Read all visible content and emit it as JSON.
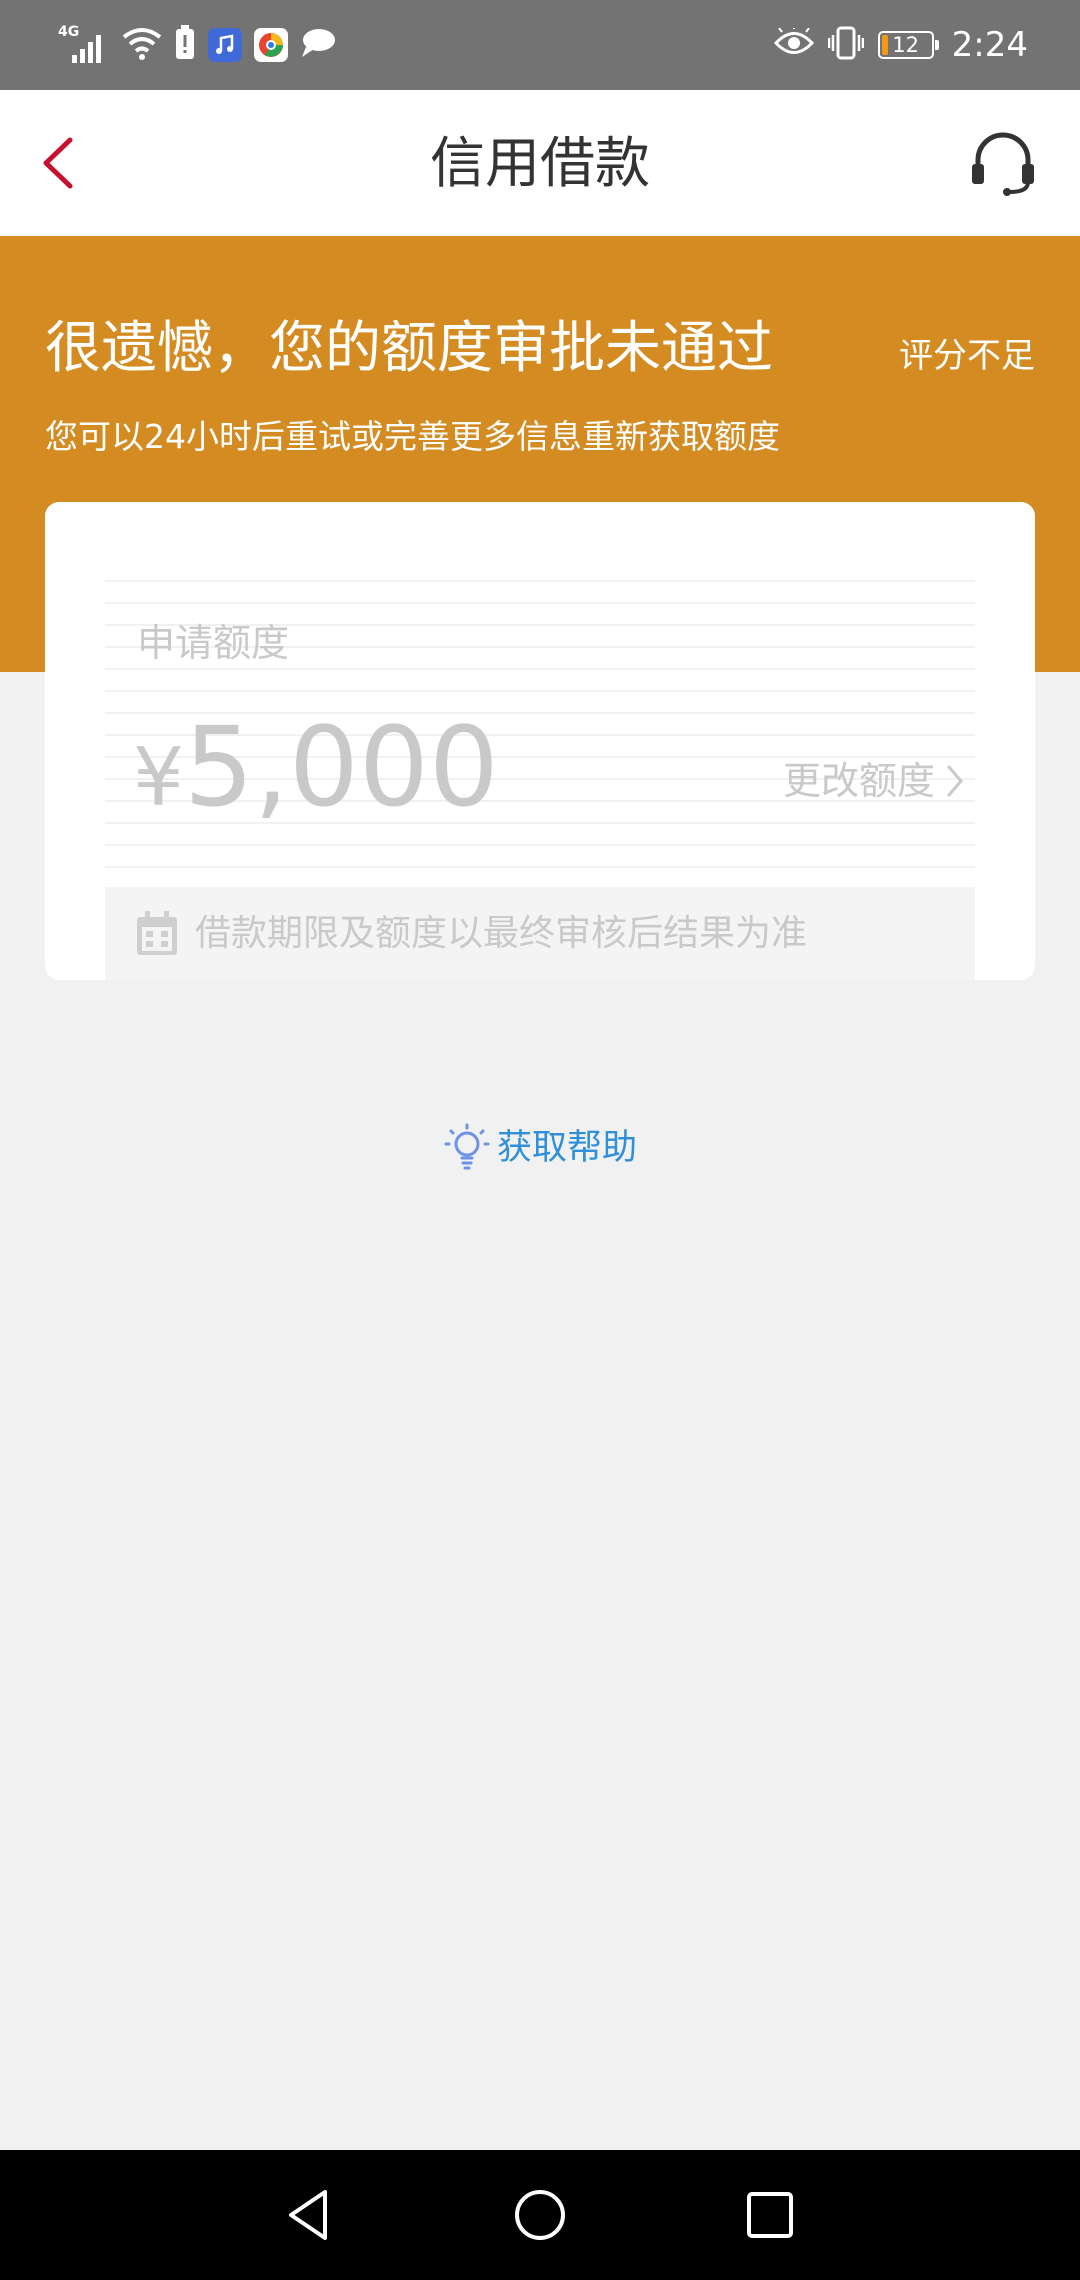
{
  "status_bar": {
    "network_type": "4G",
    "time": "2:24",
    "battery_level": "12",
    "battery_fraction": 0.12,
    "left_icons": [
      "signal-icon",
      "wifi-icon",
      "battery-alert-icon",
      "music-app-icon",
      "browser-app-icon",
      "chat-bubble-icon"
    ],
    "right_icons": [
      "eye-icon",
      "vibrate-icon",
      "battery-icon"
    ]
  },
  "header": {
    "title": "信用借款",
    "back_icon": "chevron-left-icon",
    "support_icon": "headset-icon"
  },
  "banner": {
    "title": "很遗憾，您的额度审批未通过",
    "score": "评分不足",
    "subtitle": "您可以24小时后重试或完善更多信息重新获取额度",
    "background_color": "#d38b22"
  },
  "card": {
    "amount_label": "申请额度",
    "currency": "¥",
    "amount": "5,000",
    "change_label": "更改额度",
    "notice": "借款期限及额度以最终审核后结果为准",
    "notice_icon": "calendar-icon"
  },
  "help": {
    "label": "获取帮助",
    "icon": "lightbulb-icon",
    "color": "#2f8fd8"
  },
  "nav_bar": {
    "icons": [
      "nav-back-icon",
      "nav-home-icon",
      "nav-recent-icon"
    ]
  }
}
